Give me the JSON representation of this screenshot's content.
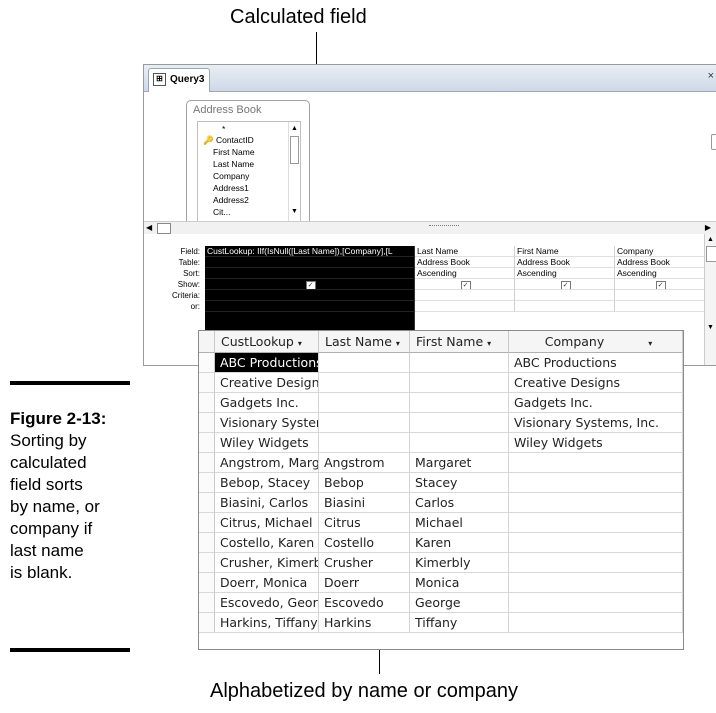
{
  "callouts": {
    "top": "Calculated field",
    "bottom": "Alphabetized by name or company"
  },
  "figure": {
    "title": "Figure 2-13:",
    "caption_lines": [
      "Sorting by",
      "calculated",
      "field sorts",
      "by name, or",
      "company if",
      "last name",
      "is blank."
    ]
  },
  "query_window": {
    "tab_label": "Query3",
    "close_glyph": "×",
    "table": {
      "title": "Address Book",
      "fields": [
        "*",
        "ContactID",
        "First Name",
        "Last Name",
        "Company",
        "Address1",
        "Address2",
        "Cit..."
      ]
    },
    "grid": {
      "row_labels": [
        "Field:",
        "Table:",
        "Sort:",
        "Show:",
        "Criteria:",
        "or:"
      ],
      "columns": [
        {
          "field": "CustLookup: IIf(IsNull([Last Name]),[Company],[L",
          "table": "",
          "sort": "",
          "show": true
        },
        {
          "field": "Last Name",
          "table": "Address Book",
          "sort": "Ascending",
          "show": true
        },
        {
          "field": "First Name",
          "table": "Address Book",
          "sort": "Ascending",
          "show": true
        },
        {
          "field": "Company",
          "table": "Address Book",
          "sort": "Ascending",
          "show": true
        }
      ]
    }
  },
  "datasheet": {
    "columns": [
      "CustLookup",
      "Last Name",
      "First Name",
      "Company"
    ],
    "rows": [
      [
        "ABC Productions",
        "",
        "",
        "ABC Productions"
      ],
      [
        "Creative Designs",
        "",
        "",
        "Creative Designs"
      ],
      [
        "Gadgets Inc.",
        "",
        "",
        "Gadgets Inc."
      ],
      [
        "Visionary Systems, Inc.",
        "",
        "",
        "Visionary Systems, Inc."
      ],
      [
        "Wiley Widgets",
        "",
        "",
        "Wiley Widgets"
      ],
      [
        "Angstrom, Margaret",
        "Angstrom",
        "Margaret",
        ""
      ],
      [
        "Bebop, Stacey",
        "Bebop",
        "Stacey",
        ""
      ],
      [
        "Biasini, Carlos",
        "Biasini",
        "Carlos",
        ""
      ],
      [
        "Citrus, Michael",
        "Citrus",
        "Michael",
        ""
      ],
      [
        "Costello, Karen",
        "Costello",
        "Karen",
        ""
      ],
      [
        "Crusher, Kimerbly",
        "Crusher",
        "Kimerbly",
        ""
      ],
      [
        "Doerr, Monica",
        "Doerr",
        "Monica",
        ""
      ],
      [
        "Escovedo, George",
        "Escovedo",
        "George",
        ""
      ],
      [
        "Harkins, Tiffany",
        "Harkins",
        "Tiffany",
        ""
      ]
    ]
  }
}
